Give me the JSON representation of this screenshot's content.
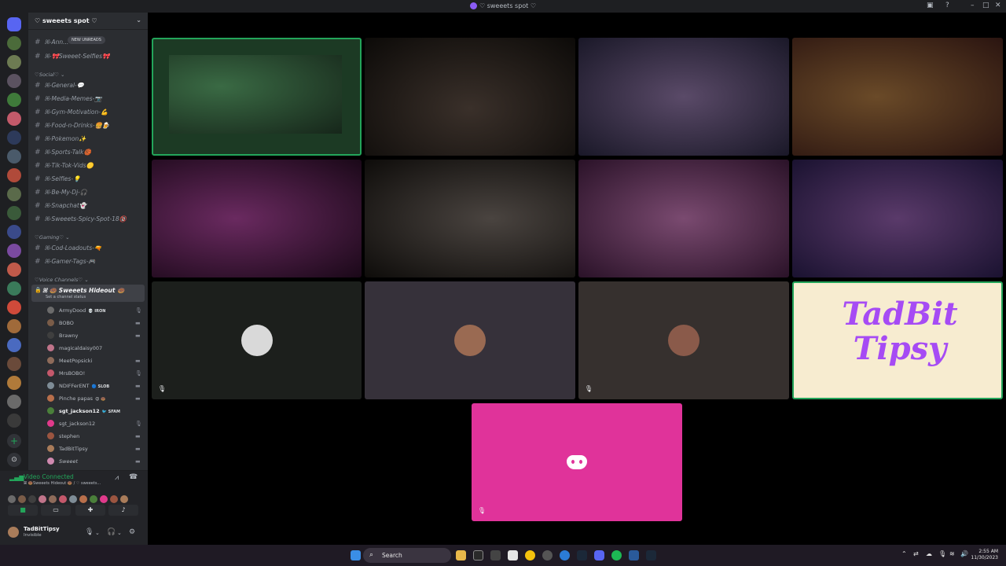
{
  "window": {
    "title": "♡ sweeets spot ♡"
  },
  "guild": {
    "name": "♡ sweeets spot ♡",
    "new_unreads": "NEW UNREADS"
  },
  "channels": [
    {
      "name": "ꕤ-Ann..."
    },
    {
      "name": "ꕤ-🎀Sweeet-Selfies🎀"
    },
    {
      "category": "♡Social♡ ⌄"
    },
    {
      "name": "ꕤ-General-💬"
    },
    {
      "name": "ꕤ-Media-Memes-📷"
    },
    {
      "name": "ꕤ-Gym-Motivation-💪"
    },
    {
      "name": "ꕤ-Food-n-Drinks-🍔🍺"
    },
    {
      "name": "ꕤ-Pokemon✨"
    },
    {
      "name": "ꕤ-Sports-Talk🏀"
    },
    {
      "name": "ꕤ-Tik-Tok-Vids🟡"
    },
    {
      "name": "ꕤ-Selfies-💡"
    },
    {
      "name": "ꕤ-Be-My-Dj-🎧"
    },
    {
      "name": "ꕤ-Snapchat👻"
    },
    {
      "name": "ꕤ-Sweeets-Spicy-Spot-18🔞"
    },
    {
      "category": "♡Gaming♡ ⌄"
    },
    {
      "name": "ꕤ-Cod-Loadouts-🔫"
    },
    {
      "name": "ꕤ-Gamer-Tags-🎮"
    },
    {
      "category": "♡Voice Channels♡ ⌄"
    }
  ],
  "voice_channel": {
    "name": "ꕤ 🍩 Sweeets Hideout 🍩",
    "status": "Set a channel status"
  },
  "members": [
    {
      "name": "ArmyDood",
      "tag": "💀 IRON",
      "color": "#6b6b6b"
    },
    {
      "name": "BOBO",
      "tag": "",
      "color": "#7a5c48"
    },
    {
      "name": "Brawny",
      "tag": "",
      "color": "#3f3f3f"
    },
    {
      "name": "magicaldaisy007",
      "tag": "",
      "color": "#c0748a"
    },
    {
      "name": "MeetPopsicki",
      "tag": "",
      "color": "#8e6b5a"
    },
    {
      "name": "MrsBOBO!",
      "tag": "",
      "color": "#c4586b"
    },
    {
      "name": "NDIFFerENT",
      "tag": "🔵 SLOB",
      "color": "#7e8c96"
    },
    {
      "name": "Pinche papas",
      "tag": "😊 🍩",
      "color": "#b86f4b"
    },
    {
      "name": "sgt_jackson12",
      "tag": "🐦 SFAM",
      "color": "#4a7f3a"
    },
    {
      "name": "sgt_jackson12",
      "tag": "",
      "color": "#e03a8b"
    },
    {
      "name": "stephen",
      "tag": "",
      "color": "#9b5540"
    },
    {
      "name": "TadBitTipsy",
      "tag": "",
      "color": "#a97c5a"
    },
    {
      "name": "Sweeet",
      "tag": "",
      "color": "#d08ab0"
    }
  ],
  "voice_panel": {
    "status": "Video Connected",
    "location": "ꕤ 🍩Sweeets Hideout 🍩 / ♡ sweeets..."
  },
  "user": {
    "name": "TadBitTipsy",
    "status": "Invisible"
  },
  "stage": {
    "logo_text_1": "TadBit",
    "logo_text_2": "Tipsy",
    "tiles": [
      {
        "kind": "video",
        "color": "#1c3a24",
        "highlight": true
      },
      {
        "kind": "video",
        "color": "#141210"
      },
      {
        "kind": "video",
        "color": "#2a2436"
      },
      {
        "kind": "video",
        "color": "#3a2418"
      },
      {
        "kind": "video",
        "color": "#3b1a38"
      },
      {
        "kind": "video",
        "color": "#1a1816"
      },
      {
        "kind": "video",
        "color": "#4a2846"
      },
      {
        "kind": "video",
        "color": "#2e2240"
      },
      {
        "kind": "avatar",
        "color": "#1c1f1c",
        "avatar_color": "#d9d9d9",
        "muted": true
      },
      {
        "kind": "avatar",
        "color": "#36313a",
        "avatar_color": "#9a6a52",
        "muted": false
      },
      {
        "kind": "avatar",
        "color": "#36302e",
        "avatar_color": "#8a5a4a",
        "muted": true
      },
      {
        "kind": "logo",
        "color": "#f7ecd0"
      },
      {
        "kind": "discord",
        "color": "#e0339a",
        "muted": true
      }
    ]
  },
  "taskbar": {
    "search": "Search",
    "time": "2:55 AM",
    "date": "11/30/2023"
  },
  "colors": {
    "accent_green": "#23a55a",
    "discord_blurple": "#5865f2",
    "logo_purple": "#a64bf4"
  }
}
